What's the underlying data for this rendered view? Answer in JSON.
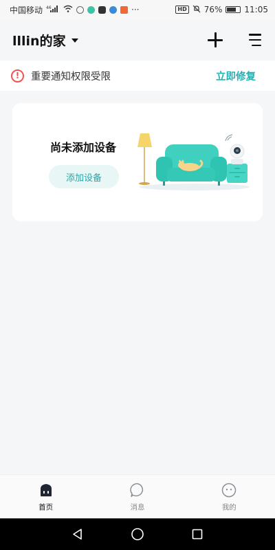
{
  "status_bar": {
    "carrier": "中国移动",
    "signal_label": "4G",
    "battery": "76%",
    "battery_level": 0.76,
    "time": "11:05",
    "more": "···"
  },
  "header": {
    "home_name": "lllin的家",
    "add_icon": "plus-icon",
    "menu_icon": "menu-icon"
  },
  "notice": {
    "text": "重要通知权限受限",
    "action": "立即修复",
    "color": "#ef5350"
  },
  "device_card": {
    "empty_text": "尚未添加设备",
    "add_button": "添加设备"
  },
  "bottom_nav": {
    "items": [
      {
        "label": "首页",
        "icon": "home-icon",
        "active": true
      },
      {
        "label": "消息",
        "icon": "message-icon",
        "active": false
      },
      {
        "label": "我的",
        "icon": "profile-icon",
        "active": false
      }
    ]
  },
  "colors": {
    "accent": "#23b3b5",
    "warning": "#ef5350",
    "background": "#f5f6f8"
  }
}
